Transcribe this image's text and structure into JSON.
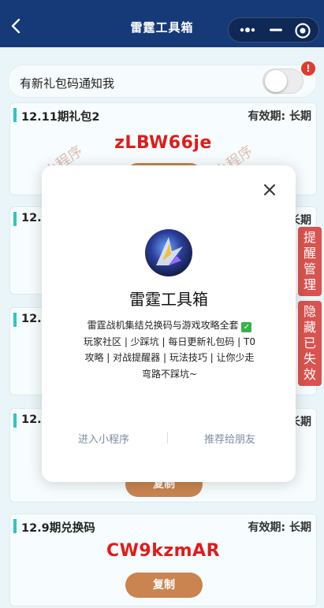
{
  "nav": {
    "title": "雷霆工具箱",
    "back_icon": "chevron-left-icon",
    "bg_color": "#163a78"
  },
  "notify": {
    "label": "有新礼包码通知我",
    "badge": "!",
    "toggle_on": false
  },
  "cards": [
    {
      "title": "12.11期礼包2",
      "validity": "有效期: 长期",
      "code": "zLBW66je",
      "watermark": "小程序"
    },
    {
      "title": "12.1",
      "validity": "长期"
    },
    {
      "title": "12.1"
    },
    {
      "title": "12.1",
      "validity": "长期",
      "copy": "复制"
    },
    {
      "title": "12.9期兑换码",
      "validity": "有效期: 长期",
      "code": "CW9kzmAR",
      "copy": "复制"
    }
  ],
  "side": {
    "remind": "提醒管理",
    "hide": "隐藏已失效",
    "color": "#d9534f"
  },
  "modal": {
    "app_name": "雷霆工具箱",
    "desc": "雷霆战机集结兑换码与游戏攻略全套",
    "desc_rest": "玩家社区 | 少踩坑 | 每日更新礼包码 | T0攻略 | 对战提醒器 | 玩法技巧 | 让你少走弯路不踩坑~",
    "enter": "进入小程序",
    "share": "推荐给朋友"
  },
  "colors": {
    "code_red": "#e01b1b",
    "copy_btn": "#c98450",
    "accent_bar": "#2ec4c8"
  }
}
